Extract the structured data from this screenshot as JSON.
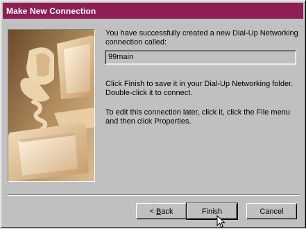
{
  "window": {
    "title": "Make New Connection"
  },
  "illustration": {
    "icon": "computer-and-telephone-picture"
  },
  "content": {
    "success_message": "You have successfully created a new Dial-Up Networking connection called:",
    "connection_name": "99main",
    "finish_instructions": "Click Finish to save it in your Dial-Up Networking folder. Double-click it to connect.",
    "edit_instructions": "To edit this connection later, click it, click the File menu and then click Properties."
  },
  "buttons": {
    "back_prefix": "< ",
    "back_mnemonic": "B",
    "back_rest": "ack",
    "finish_label": "Finish",
    "cancel_label": "Cancel"
  },
  "colors": {
    "title_bar": "#8e1e53",
    "face": "#c0c0c0"
  }
}
